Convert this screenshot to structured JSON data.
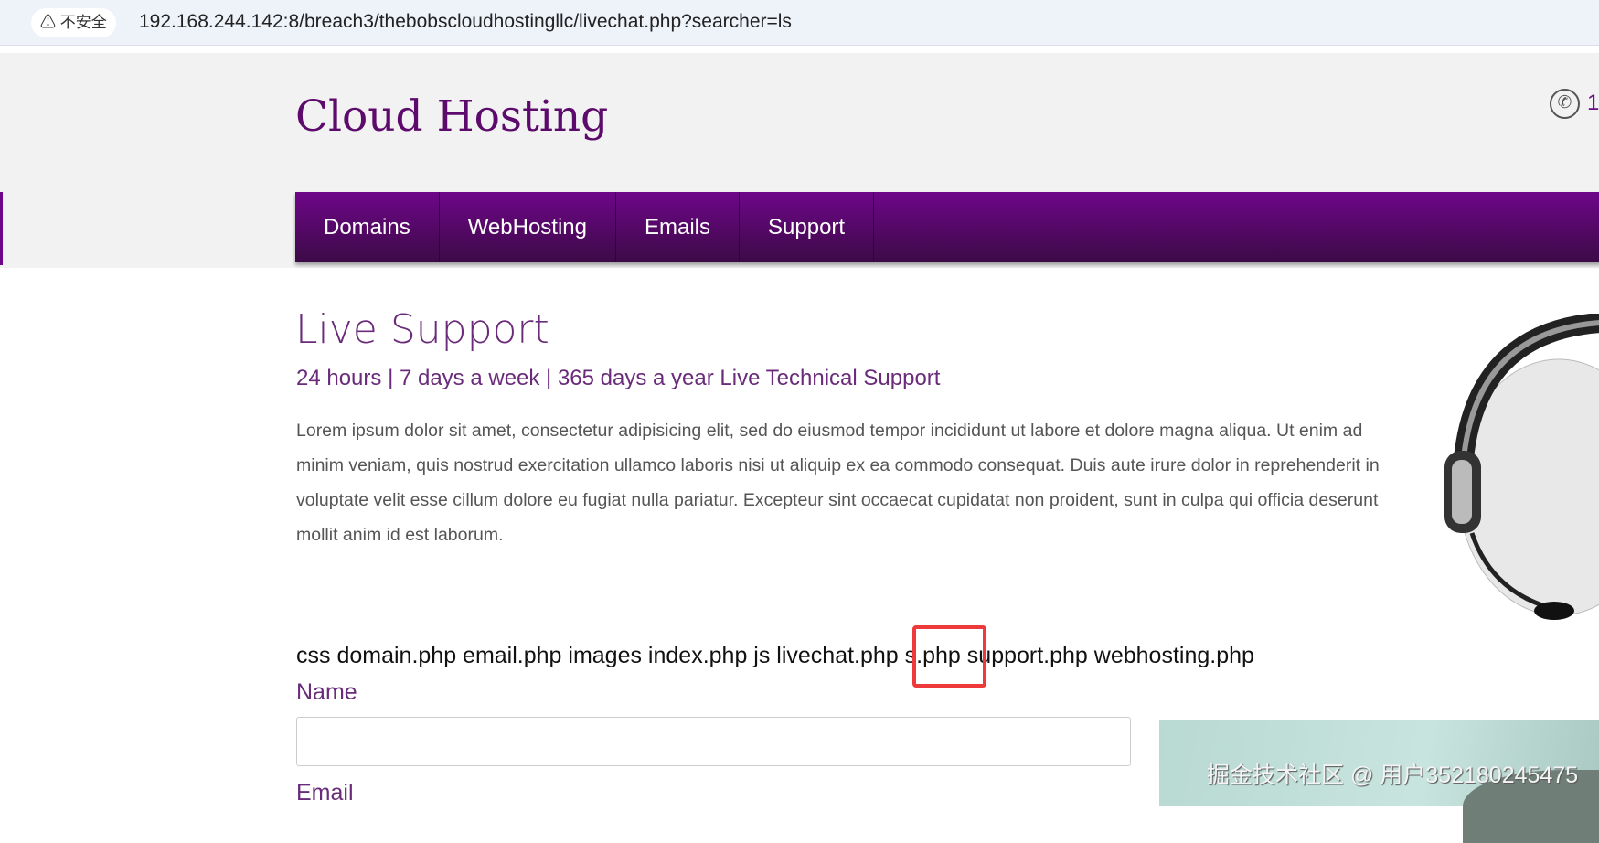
{
  "browser": {
    "security_label": "⚠ 不安全",
    "url": "192.168.244.142:8/breach3/thebobscloudhostingllc/livechat.php?searcher=ls"
  },
  "header": {
    "logo": "Cloud Hosting",
    "phone_icon": "phone-icon",
    "phone_text": "1"
  },
  "nav": {
    "items": [
      {
        "label": "Domains"
      },
      {
        "label": "WebHosting"
      },
      {
        "label": "Emails"
      },
      {
        "label": "Support"
      }
    ]
  },
  "main": {
    "title": "Live Support",
    "subtitle": "24 hours | 7 days a week | 365 days a year Live Technical Support",
    "paragraph": "Lorem ipsum dolor sit amet, consectetur adipisicing elit, sed do eiusmod tempor incididunt ut labore et dolore magna aliqua. Ut enim ad minim veniam, quis nostrud exercitation ullamco laboris nisi ut aliquip ex ea commodo consequat. Duis aute irure dolor in reprehenderit in voluptate velit esse cillum dolore eu fugiat nulla pariatur. Excepteur sint occaecat cupidatat non proident, sunt in culpa qui officia deserunt mollit anim id est laborum.",
    "listing_before": "css domain.php email.php images index.php js livechat.php ",
    "listing_highlight": "s.php",
    "listing_after": " support.php webhosting.php",
    "highlight_color": "#ee3a3a"
  },
  "form": {
    "name_label": "Name",
    "name_value": "",
    "email_label": "Email"
  },
  "watermark": "掘金技术社区 @ 用户3521802454​75",
  "colors": {
    "brand": "#6e0689",
    "heading": "#6a2c7a"
  }
}
